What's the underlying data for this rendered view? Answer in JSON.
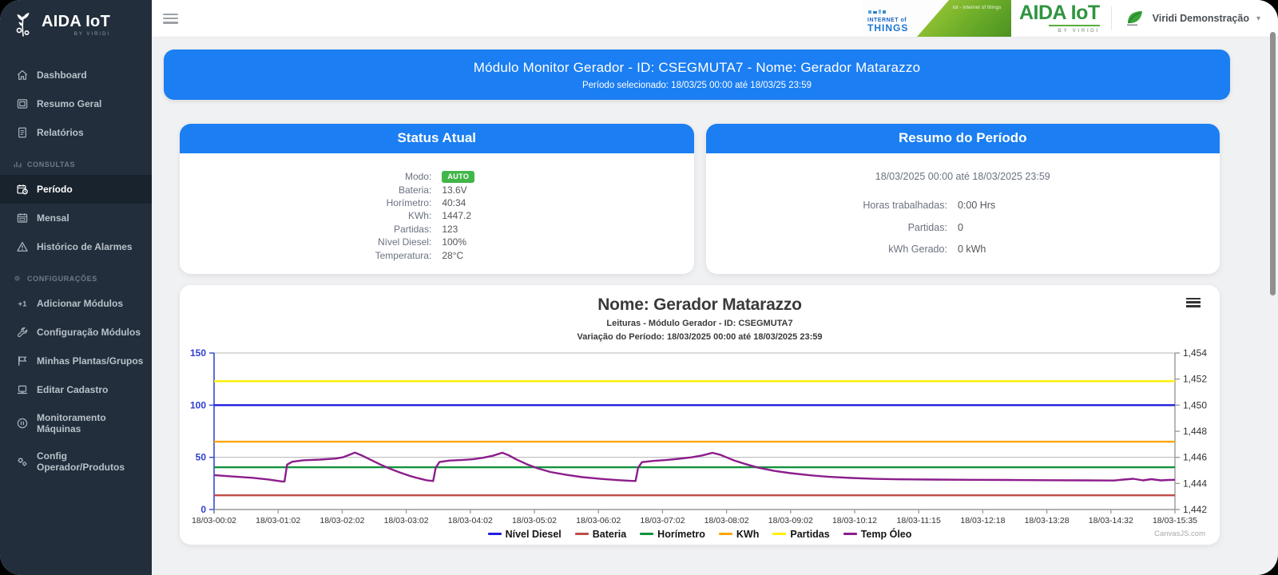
{
  "colors": {
    "accent_blue": "#1b7ef2",
    "badge_green": "#43b649",
    "sidebar_bg": "#222e3c",
    "sidebar_active_bg": "#19232e",
    "main_bg": "#f0f1f3",
    "header_logo_green": "#2f9440"
  },
  "sidebar": {
    "logo_title": "AIDA IoT",
    "logo_subtitle": "BY VIRIDI",
    "items": [
      {
        "type": "item",
        "label": "Dashboard",
        "icon": "home-icon",
        "active": false
      },
      {
        "type": "item",
        "label": "Resumo Geral",
        "icon": "summary-icon",
        "active": false
      },
      {
        "type": "item",
        "label": "Relatórios",
        "icon": "report-icon",
        "active": false
      },
      {
        "type": "section",
        "label": "CONSULTAS",
        "icon": "bar-chart-icon"
      },
      {
        "type": "item",
        "label": "Período",
        "icon": "calendar-clock-icon",
        "active": true
      },
      {
        "type": "item",
        "label": "Mensal",
        "icon": "calendar-icon",
        "active": false
      },
      {
        "type": "item",
        "label": "Histórico de Alarmes",
        "icon": "warning-icon",
        "active": false
      },
      {
        "type": "section",
        "label": "CONFIGURAÇÕES",
        "icon": "gear-icon"
      },
      {
        "type": "item",
        "label": "Adicionar Módulos",
        "icon": "add-module-icon",
        "active": false
      },
      {
        "type": "item",
        "label": "Configuração Módulos",
        "icon": "wrench-icon",
        "active": false
      },
      {
        "type": "item",
        "label": "Minhas Plantas/Grupos",
        "icon": "flag-icon",
        "active": false
      },
      {
        "type": "item",
        "label": "Editar Cadastro",
        "icon": "laptop-icon",
        "active": false
      },
      {
        "type": "item",
        "label": "Monitoramento Máquinas",
        "icon": "pause-circle-icon",
        "active": false
      },
      {
        "type": "item",
        "label": "Config Operador/Produtos",
        "icon": "gears-icon",
        "active": false
      }
    ]
  },
  "header": {
    "collage": {
      "line1": "INTERNET of",
      "line2": "THINGS",
      "diagonal": "iot - internet of things"
    },
    "logo_text": "AIDA IoT",
    "logo_sub": "BY VIRIDI",
    "user_name": "Viridi Demonstração",
    "user_caret": "▾"
  },
  "banner": {
    "title": "Módulo Monitor Gerador - ID: CSEGMUTA7 - Nome: Gerador Matarazzo",
    "subtitle": "Período selecionado: 18/03/25 00:00 até 18/03/25 23:59"
  },
  "status_card": {
    "title": "Status Atual",
    "rows": [
      {
        "label": "Modo:",
        "value": "AUTO",
        "badge": true
      },
      {
        "label": "Bateria:",
        "value": "13.6V",
        "badge": false
      },
      {
        "label": "Horímetro:",
        "value": "40:34",
        "badge": false
      },
      {
        "label": "KWh:",
        "value": "1447.2",
        "badge": false
      },
      {
        "label": "Partidas:",
        "value": "123",
        "badge": false
      },
      {
        "label": "Nível Diesel:",
        "value": "100%",
        "badge": false
      },
      {
        "label": "Temperatura:",
        "value": "28°C",
        "badge": false
      }
    ]
  },
  "summary_card": {
    "title": "Resumo do Período",
    "period": "18/03/2025 00:00 até 18/03/2025 23:59",
    "rows": [
      {
        "label": "Horas trabalhadas:",
        "value": "0:00 Hrs"
      },
      {
        "label": "Partidas:",
        "value": "0"
      },
      {
        "label": "kWh Gerado:",
        "value": "0 kWh"
      }
    ]
  },
  "chart_data": {
    "type": "line",
    "title": "Nome: Gerador Matarazzo",
    "subtitle1": "Leituras - Módulo Gerador - ID: CSEGMUTA7",
    "subtitle2": "Variação do Período: 18/03/2025 00:00 até 18/03/2025 23:59",
    "legend_position": "bottom",
    "grid": true,
    "credit": "CanvasJS.com",
    "x_labels": [
      "18/03-00:02",
      "18/03-01:02",
      "18/03-02:02",
      "18/03-03:02",
      "18/03-04:02",
      "18/03-05:02",
      "18/03-06:02",
      "18/03-07:02",
      "18/03-08:02",
      "18/03-09:02",
      "18/03-10:12",
      "18/03-11:15",
      "18/03-12:18",
      "18/03-13:28",
      "18/03-14:32",
      "18/03-15:35"
    ],
    "y_left": {
      "min": 0,
      "max": 150,
      "ticks": [
        0,
        50,
        100,
        150
      ],
      "label_color": "#2d3fd0"
    },
    "y_right": {
      "min": 1442,
      "max": 1454,
      "ticks": [
        "1,442",
        "1,444",
        "1,446",
        "1,448",
        "1,450",
        "1,452",
        "1,454"
      ],
      "label_color": "#333333"
    },
    "series": [
      {
        "name": "Nível Diesel",
        "color": "#1f1fdd",
        "axis": "left",
        "constant": 100
      },
      {
        "name": "Bateria",
        "color": "#bf4c47",
        "axis": "left",
        "constant": 13.6
      },
      {
        "name": "Horímetro",
        "color": "#11923d",
        "axis": "left",
        "constant": 40.5
      },
      {
        "name": "KWh",
        "color": "#ffa500",
        "axis": "right",
        "constant": 1447.2
      },
      {
        "name": "Partidas",
        "color": "#ffef00",
        "axis": "left",
        "constant": 123
      },
      {
        "name": "Temp Óleo",
        "color": "#8c1d8c",
        "axis": "left",
        "points": [
          [
            0,
            33
          ],
          [
            0.3,
            31.6
          ],
          [
            0.6,
            30.4
          ],
          [
            0.85,
            28.8
          ],
          [
            1.0,
            27.4
          ],
          [
            1.07,
            26.9
          ],
          [
            1.1,
            26.9
          ],
          [
            1.14,
            43
          ],
          [
            1.22,
            45.8
          ],
          [
            1.4,
            47.2
          ],
          [
            1.65,
            47.8
          ],
          [
            1.9,
            48.8
          ],
          [
            2.02,
            50.2
          ],
          [
            2.12,
            52.6
          ],
          [
            2.2,
            54.6
          ],
          [
            2.3,
            52
          ],
          [
            2.45,
            47.5
          ],
          [
            2.6,
            43
          ],
          [
            2.75,
            39
          ],
          [
            2.9,
            35.5
          ],
          [
            3.05,
            32.3
          ],
          [
            3.2,
            29.8
          ],
          [
            3.32,
            28
          ],
          [
            3.42,
            27.3
          ],
          [
            3.46,
            40
          ],
          [
            3.52,
            45.6
          ],
          [
            3.68,
            46.9
          ],
          [
            3.88,
            47.5
          ],
          [
            4.05,
            48.3
          ],
          [
            4.2,
            49.6
          ],
          [
            4.35,
            51.5
          ],
          [
            4.5,
            54.4
          ],
          [
            4.6,
            52
          ],
          [
            4.72,
            48
          ],
          [
            4.88,
            43.5
          ],
          [
            5.05,
            39.5
          ],
          [
            5.25,
            36
          ],
          [
            5.5,
            33.2
          ],
          [
            5.75,
            31
          ],
          [
            6.05,
            29.3
          ],
          [
            6.3,
            28.2
          ],
          [
            6.5,
            27.5
          ],
          [
            6.58,
            27.3
          ],
          [
            6.62,
            40
          ],
          [
            6.68,
            45.4
          ],
          [
            6.85,
            46.5
          ],
          [
            7.05,
            47.4
          ],
          [
            7.25,
            48.6
          ],
          [
            7.45,
            50
          ],
          [
            7.62,
            51.8
          ],
          [
            7.78,
            54.3
          ],
          [
            7.9,
            52.5
          ],
          [
            8.0,
            50
          ],
          [
            8.12,
            47
          ],
          [
            8.3,
            43.5
          ],
          [
            8.5,
            40
          ],
          [
            8.75,
            37
          ],
          [
            9.0,
            34.8
          ],
          [
            9.3,
            32.8
          ],
          [
            9.6,
            31.3
          ],
          [
            9.95,
            30.2
          ],
          [
            10.3,
            29.4
          ],
          [
            10.7,
            28.9
          ],
          [
            11.2,
            28.7
          ],
          [
            11.8,
            28.5
          ],
          [
            12.4,
            28.3
          ],
          [
            13.0,
            28.1
          ],
          [
            13.6,
            27.9
          ],
          [
            14.05,
            27.8
          ],
          [
            14.2,
            28.7
          ],
          [
            14.35,
            29.5
          ],
          [
            14.5,
            27.9
          ],
          [
            14.63,
            29.1
          ],
          [
            14.78,
            27.9
          ],
          [
            14.9,
            28.3
          ],
          [
            15,
            28.5
          ]
        ]
      }
    ]
  }
}
